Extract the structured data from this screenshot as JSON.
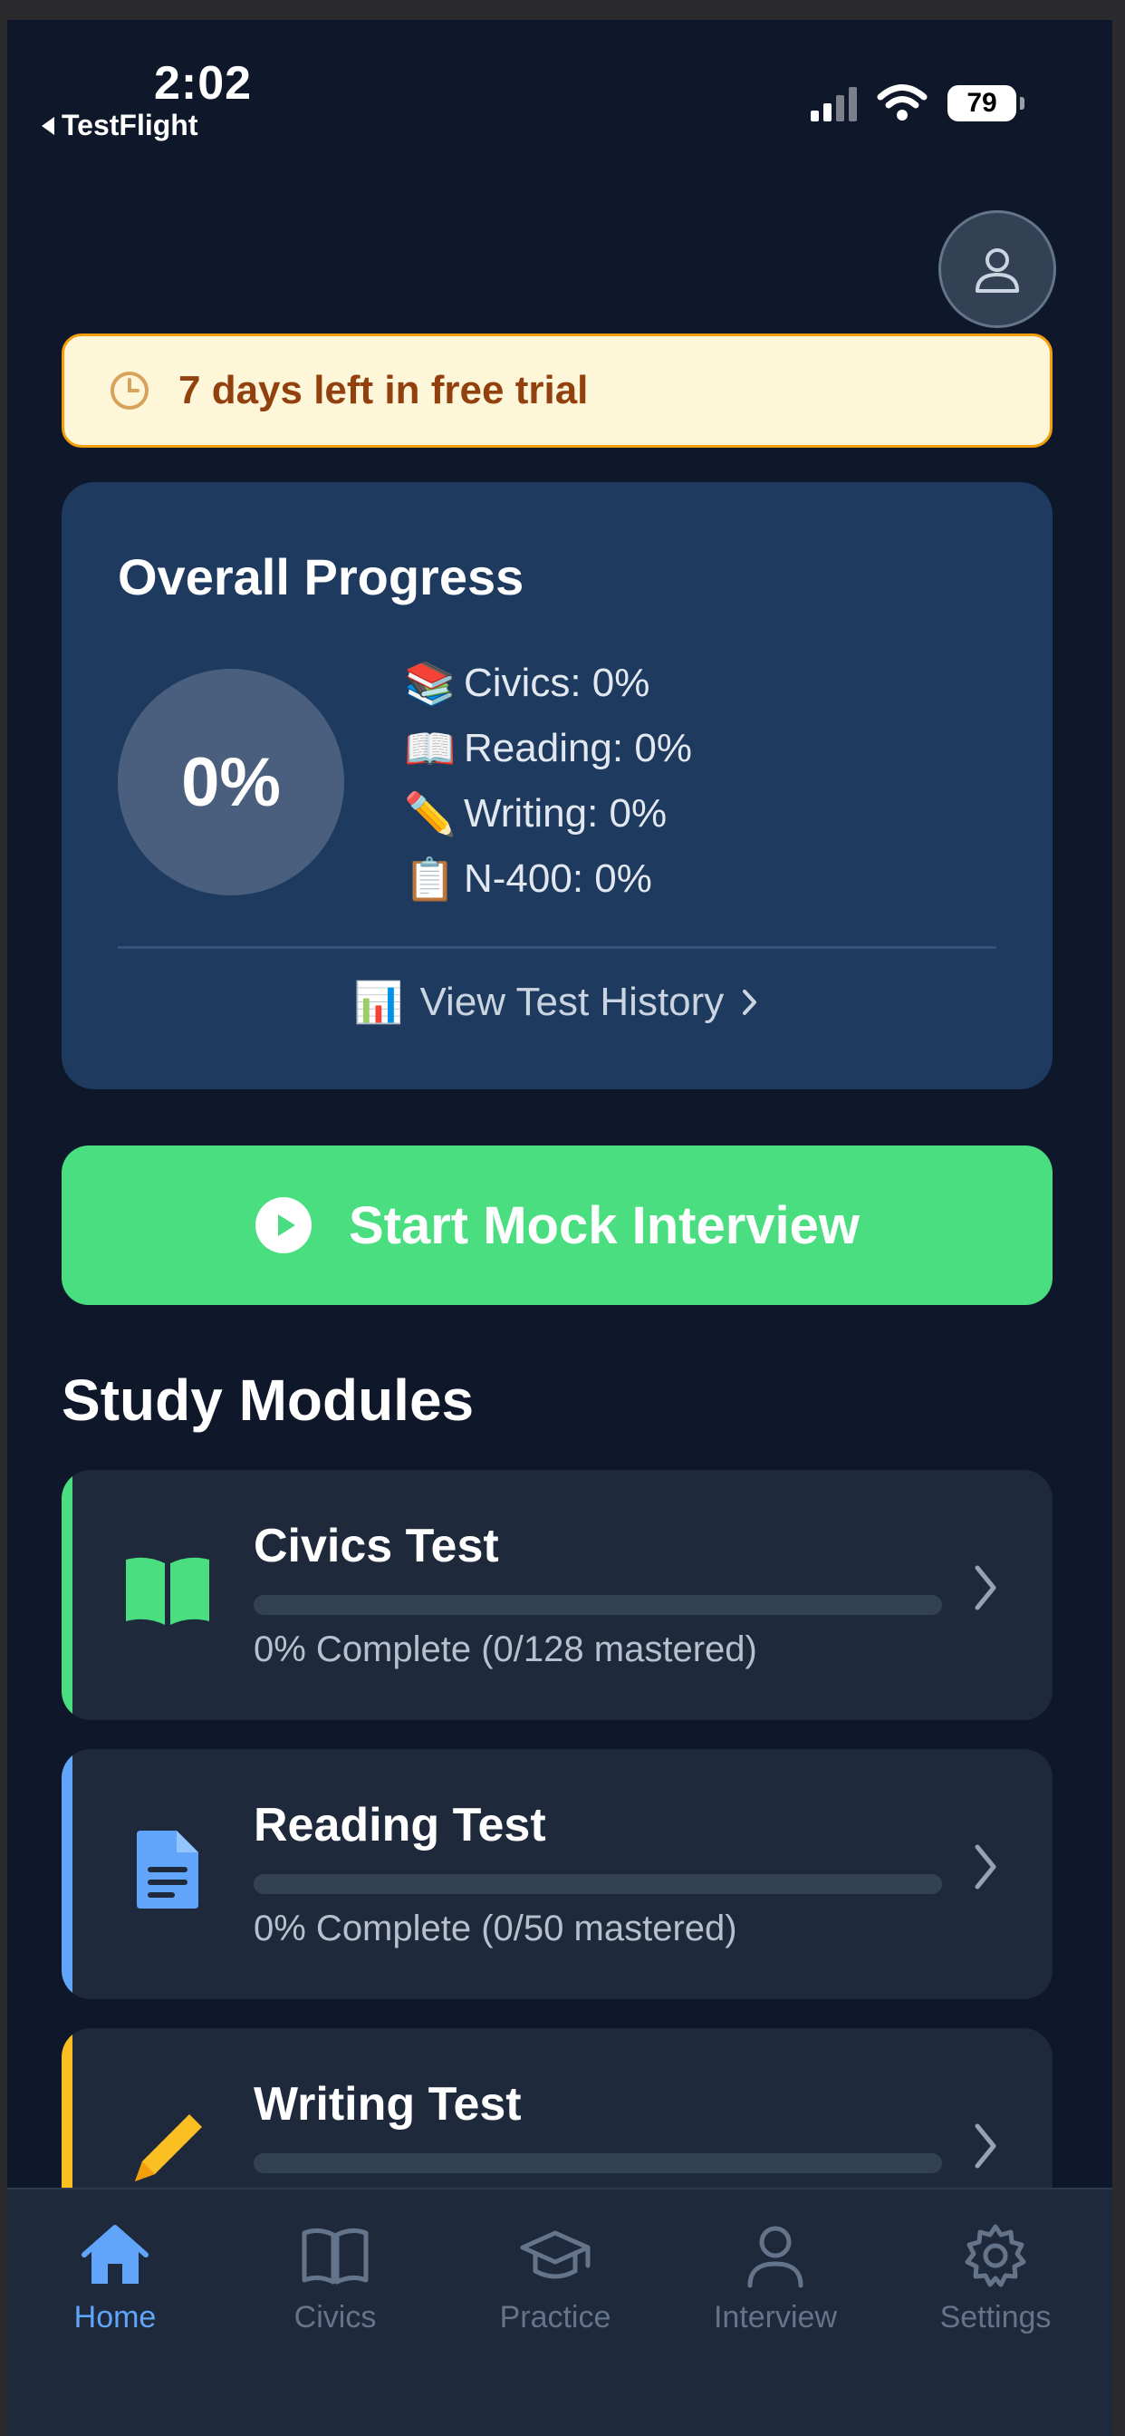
{
  "status_bar": {
    "time": "2:02",
    "back_app": "TestFlight",
    "battery": "79"
  },
  "trial": {
    "text": "7 days left in free trial"
  },
  "progress": {
    "title": "Overall Progress",
    "overall": "0%",
    "stats": [
      {
        "emoji": "📚",
        "label": "Civics: 0%"
      },
      {
        "emoji": "📖",
        "label": "Reading: 0%"
      },
      {
        "emoji": "✏️",
        "label": "Writing: 0%"
      },
      {
        "emoji": "📋",
        "label": "N-400: 0%"
      }
    ],
    "history_emoji": "📊",
    "history_label": "View Test History"
  },
  "cta": {
    "label": "Start Mock Interview"
  },
  "study": {
    "title": "Study Modules",
    "modules": [
      {
        "title": "Civics Test",
        "subtitle": "0% Complete (0/128 mastered)",
        "progress": 0,
        "accent": "#4ade80",
        "icon": "book-icon"
      },
      {
        "title": "Reading Test",
        "subtitle": "0% Complete (0/50 mastered)",
        "progress": 0,
        "accent": "#60a5fa",
        "icon": "document-icon"
      },
      {
        "title": "Writing Test",
        "subtitle": "",
        "progress": 0,
        "accent": "#fbbf24",
        "icon": "pencil-icon"
      }
    ]
  },
  "tabs": [
    {
      "label": "Home",
      "icon": "home-icon",
      "active": true
    },
    {
      "label": "Civics",
      "icon": "book-open-icon",
      "active": false
    },
    {
      "label": "Practice",
      "icon": "graduation-cap-icon",
      "active": false
    },
    {
      "label": "Interview",
      "icon": "person-icon",
      "active": false
    },
    {
      "label": "Settings",
      "icon": "gear-icon",
      "active": false
    }
  ],
  "colors": {
    "background": "#0f172a",
    "card": "#1e293b",
    "progress_card": "#1e3a5f",
    "cta": "#4ade80",
    "trial_bg": "#fef6d8",
    "trial_border": "#f59e0b",
    "trial_text": "#92400e",
    "tab_active": "#60a5fa",
    "tab_inactive": "#64748b"
  }
}
